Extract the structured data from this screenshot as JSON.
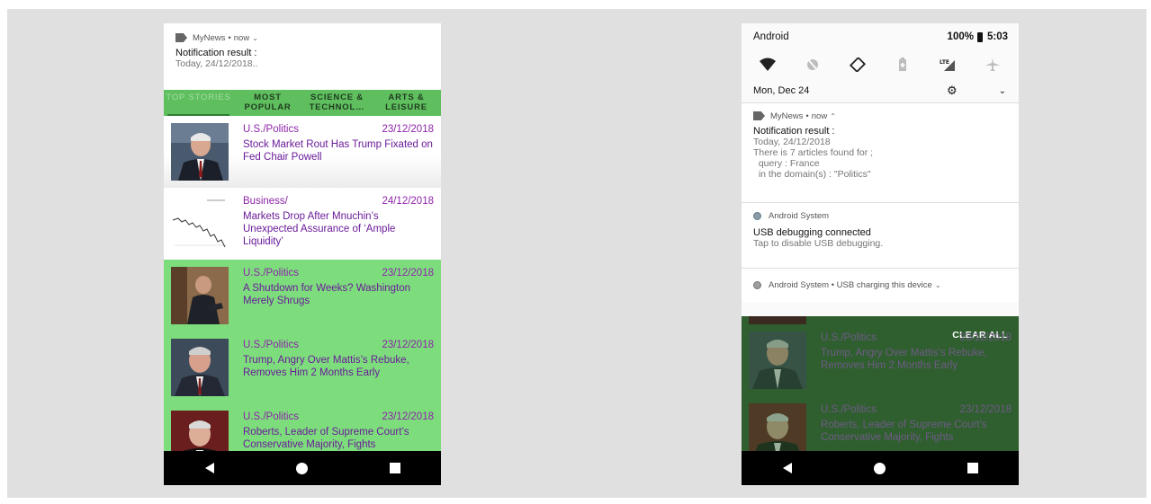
{
  "left": {
    "notification": {
      "app": "MyNews",
      "sep": "•",
      "time": "now",
      "title": "Notification result :",
      "body": "Today, 24/12/2018.."
    },
    "tabs": [
      {
        "label": "TOP STORIES"
      },
      {
        "label": "MOST POPULAR"
      },
      {
        "label": "SCIENCE & TECHNOL…"
      },
      {
        "label": "ARTS & LEISURE"
      }
    ],
    "articles": [
      {
        "section": "U.S./Politics",
        "date": "23/12/2018",
        "title": "Stock Market Rout Has Trump Fixated on Fed Chair Powell"
      },
      {
        "section": "Business/",
        "date": "24/12/2018",
        "title": "Markets Drop After Mnuchin’s Unexpected Assurance of ‘Ample Liquidity’"
      },
      {
        "section": "U.S./Politics",
        "date": "23/12/2018",
        "title": "A Shutdown for Weeks? Washington Merely Shrugs"
      },
      {
        "section": "U.S./Politics",
        "date": "23/12/2018",
        "title": "Trump, Angry Over Mattis’s Rebuke, Removes Him 2 Months Early"
      },
      {
        "section": "U.S./Politics",
        "date": "23/12/2018",
        "title": "Roberts, Leader of Supreme Court’s Conservative Majority, Fights"
      }
    ]
  },
  "right": {
    "status": {
      "carrier": "Android",
      "battery": "100%",
      "time": "5:03"
    },
    "qs_lte": "LTE",
    "date": "Mon, Dec 24",
    "mynews": {
      "app": "MyNews",
      "sep": "•",
      "time": "now",
      "title": "Notification result :",
      "lines": [
        "Today, 24/12/2018",
        "There is 7 articles found for ;",
        "  query : France",
        "  in the domain(s) : \"Politics\""
      ]
    },
    "usb": {
      "app": "Android System",
      "title": "USB debugging connected",
      "body": "Tap to disable USB debugging."
    },
    "charging": {
      "text": "Android System • USB charging this device"
    },
    "clear_all": "CLEAR ALL",
    "articles": [
      {
        "section": "U.S./Politics",
        "date": "23/12/2018",
        "title": "Trump, Angry Over Mattis’s Rebuke, Removes Him 2 Months Early"
      },
      {
        "section": "U.S./Politics",
        "date": "23/12/2018",
        "title": "Roberts, Leader of Supreme Court’s Conservative Majority, Fights"
      }
    ]
  },
  "colors": {
    "tab_bar": "#5fbf5f",
    "highlight": "#7ddd7d",
    "purple_text": "#8e24aa",
    "dim_overlay": "#2f5f2f"
  }
}
